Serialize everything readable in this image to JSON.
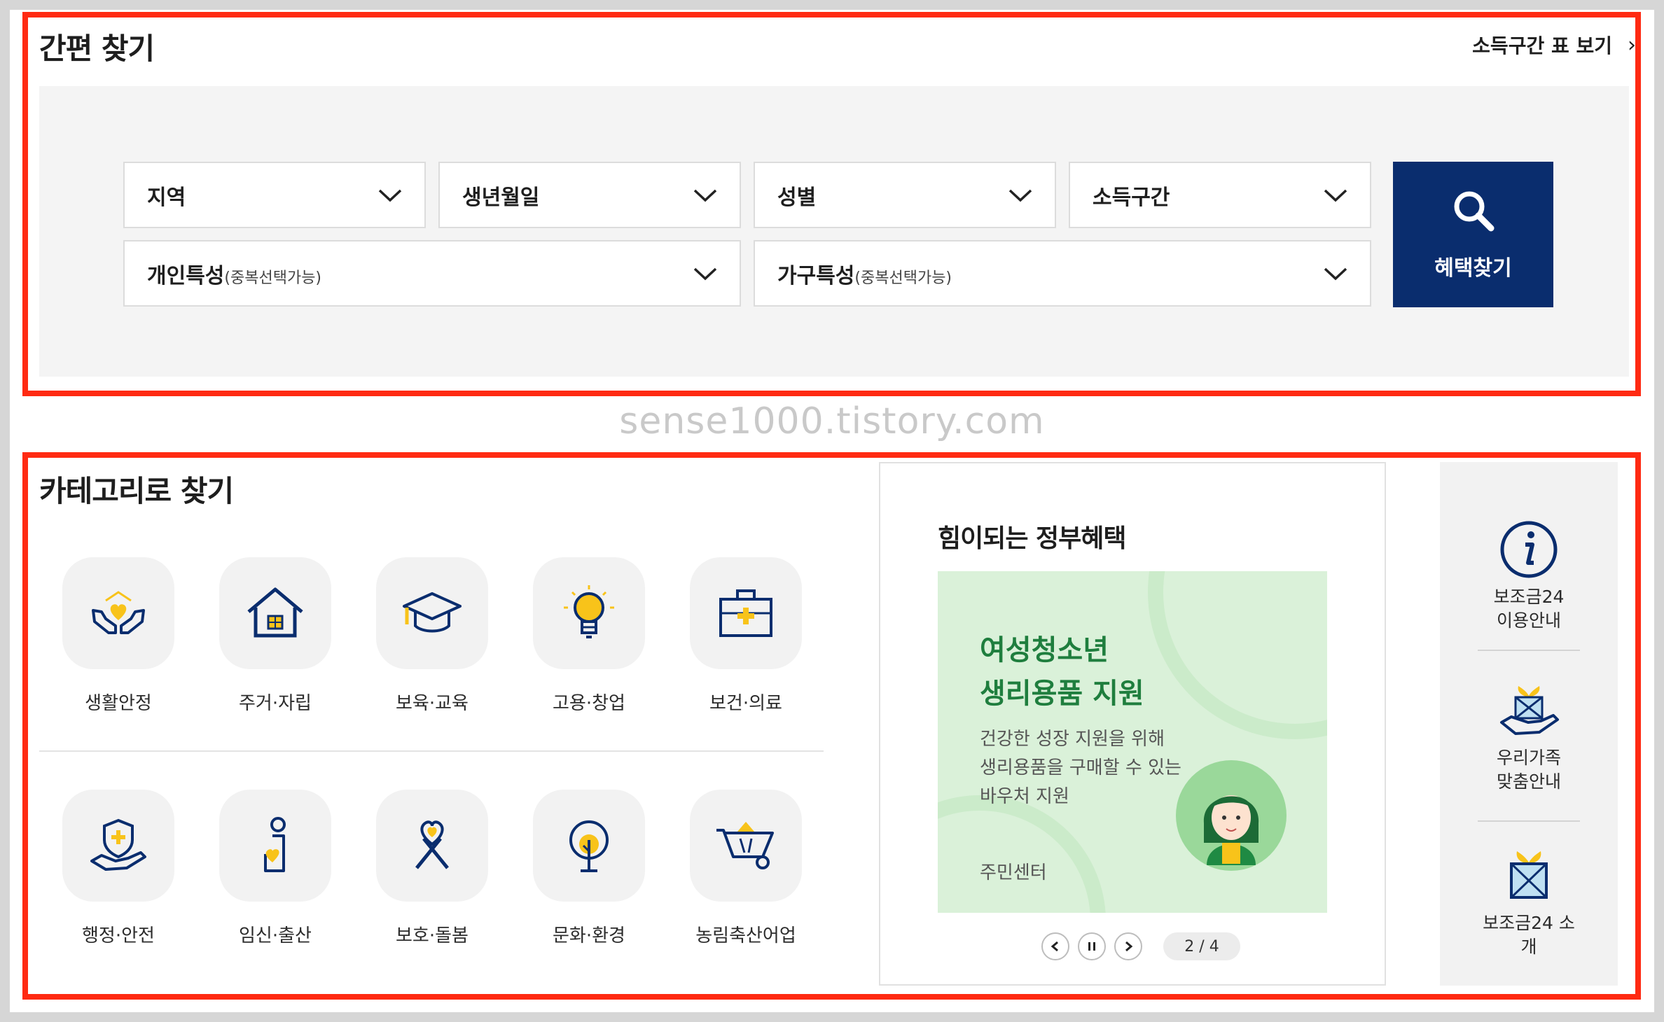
{
  "quick_search": {
    "title": "간편 찾기",
    "income_table_link": "소득구간 표 보기",
    "selects": {
      "region": "지역",
      "birth": "생년월일",
      "gender": "성별",
      "income": "소득구간",
      "personal": "개인특성",
      "personal_sub": "(중복선택가능)",
      "household": "가구특성",
      "household_sub": "(중복선택가능)"
    },
    "search_button": "혜택찾기"
  },
  "watermark": "sense1000.tistory.com",
  "category": {
    "title": "카테고리로 찾기",
    "items": [
      {
        "label": "생활안정",
        "icon": "hands-heart-icon"
      },
      {
        "label": "주거·자립",
        "icon": "house-icon"
      },
      {
        "label": "보육·교육",
        "icon": "graduation-cap-icon"
      },
      {
        "label": "고용·창업",
        "icon": "lightbulb-icon"
      },
      {
        "label": "보건·의료",
        "icon": "medical-kit-icon"
      },
      {
        "label": "행정·안전",
        "icon": "shield-hand-icon"
      },
      {
        "label": "임신·출산",
        "icon": "pregnancy-icon"
      },
      {
        "label": "보호·돌봄",
        "icon": "ribbon-icon"
      },
      {
        "label": "문화·환경",
        "icon": "tree-icon"
      },
      {
        "label": "농림축산어업",
        "icon": "wheelbarrow-icon"
      }
    ]
  },
  "banner": {
    "card_title": "힘이되는 정부혜택",
    "headline_line1": "여성청소년",
    "headline_line2": "생리용품 지원",
    "desc_line1": "건강한 성장 지원을 위해",
    "desc_line2": "생리용품을 구매할 수 있는",
    "desc_line3": "바우처 지원",
    "place": "주민센터",
    "page_indicator": "2 / 4",
    "colors": {
      "background": "#daf1d9",
      "headline": "#1f7e3e"
    }
  },
  "side_menu": {
    "items": [
      {
        "line1": "보조금24",
        "line2": "이용안내",
        "icon": "info-icon"
      },
      {
        "line1": "우리가족",
        "line2": "맞춤안내",
        "icon": "gift-hand-icon"
      },
      {
        "line1": "보조금24 소개",
        "line2": "",
        "icon": "gift-box-icon"
      }
    ]
  },
  "colors": {
    "primary": "#0a2d6e",
    "accent": "#f8c31a",
    "highlight_border": "#ff2a12"
  }
}
